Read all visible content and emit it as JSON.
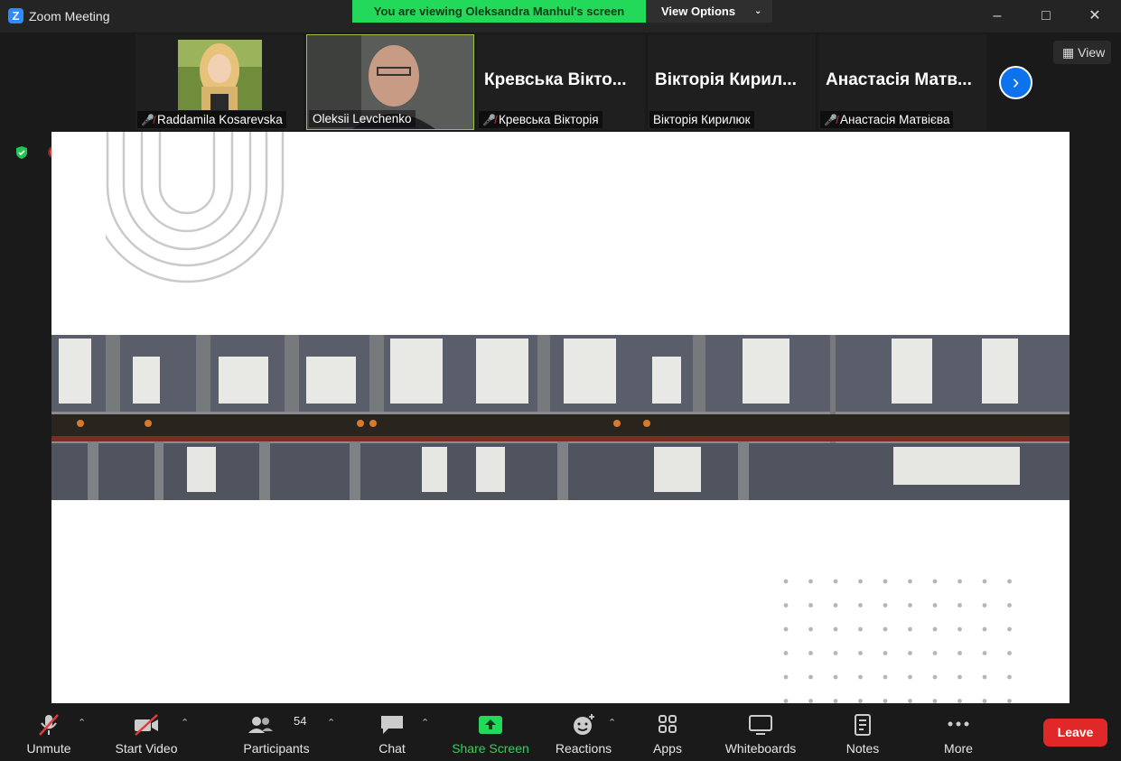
{
  "window": {
    "app_title": "Zoom Meeting"
  },
  "banner": {
    "viewing_text": "You are viewing Oleksandra Manhul's screen",
    "view_options_label": "View Options"
  },
  "participants_strip": {
    "tiles": [
      {
        "name": "Raddamila Kosarevska",
        "muted": true,
        "type": "photo"
      },
      {
        "name": "Oleksii Levchenko",
        "muted": false,
        "type": "video",
        "active_speaker": true
      },
      {
        "name": "Кревська Вікторія",
        "big_name": "Кревська Вікто...",
        "muted": true,
        "type": "name"
      },
      {
        "name": "Вікторія Кирилюк",
        "big_name": "Вікторія Кирил...",
        "muted": false,
        "type": "name"
      },
      {
        "name": "Анастасія Матвієва",
        "big_name": "Анастасія Матв...",
        "muted": true,
        "type": "name"
      }
    ],
    "view_label": "View"
  },
  "toolbar": {
    "unmute": "Unmute",
    "start_video": "Start Video",
    "participants": "Participants",
    "participants_count": "54",
    "chat": "Chat",
    "share_screen": "Share Screen",
    "reactions": "Reactions",
    "apps": "Apps",
    "whiteboards": "Whiteboards",
    "notes": "Notes",
    "more": "More",
    "leave": "Leave"
  },
  "colors": {
    "share_green": "#23d959",
    "leave_red": "#e02828",
    "active_border": "#9bc53d",
    "accent_blue": "#0e72ed"
  }
}
